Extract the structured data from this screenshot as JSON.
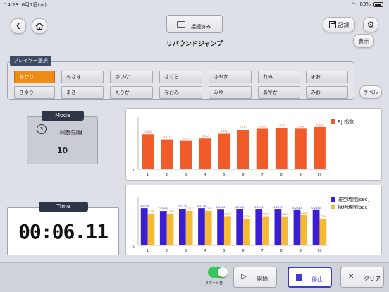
{
  "status_bar": {
    "time": "14:23",
    "date": "6月7日(水)",
    "battery": "83%"
  },
  "header": {
    "connection_label": "接続済み",
    "title": "リバウンドジャンプ",
    "record_label": "記録",
    "display_label": "表示"
  },
  "players": {
    "legend": "プレイヤー選択",
    "row1": [
      "あかり",
      "みさき",
      "ゆいな",
      "さくら",
      "さやか",
      "れみ",
      "まお"
    ],
    "row2": [
      "さゆり",
      "まき",
      "えりか",
      "なおみ",
      "みゆ",
      "あやか",
      "みお"
    ],
    "selected": "あかり",
    "label_button": "ラベル"
  },
  "mode": {
    "title": "Mode",
    "label": "回数制限",
    "value": "10",
    "icon_text": "3"
  },
  "timer": {
    "title": "Time",
    "value": "00:06.11"
  },
  "controls": {
    "start_sound_label": "スタート音",
    "start_label": "開始",
    "stop_label": "停止",
    "clear_label": "クリア"
  },
  "colors": {
    "rj": "#f15a29",
    "flight": "#3a1ed6",
    "contact": "#f5b935",
    "selected_player": "#ee8c16"
  },
  "chart_data": [
    {
      "type": "bar",
      "categories": [
        "1",
        "2",
        "3",
        "4",
        "5",
        "6",
        "7",
        "8",
        "9",
        "10"
      ],
      "series": [
        {
          "name": "RJ 指数",
          "values": [
            0.366,
            0.312,
            0.297,
            0.322,
            0.371,
            0.411,
            0.423,
            0.433,
            0.424,
            0.442
          ]
        }
      ],
      "ylim": [
        0,
        0.5
      ],
      "y_tick_labels": [
        "0"
      ],
      "legend": "top-right"
    },
    {
      "type": "bar",
      "categories": [
        "1",
        "2",
        "3",
        "4",
        "5",
        "6",
        "7",
        "8",
        "9",
        "10"
      ],
      "series": [
        {
          "name": "滞空時間[sec]",
          "values": [
            0.277,
            0.256,
            0.272,
            0.277,
            0.266,
            0.267,
            0.267,
            0.267,
            0.263,
            0.263
          ]
        },
        {
          "name": "接地時間[sec]",
          "values": [
            0.236,
            0.236,
            0.257,
            0.257,
            0.218,
            0.2,
            0.217,
            0.216,
            0.226,
            0.2
          ]
        }
      ],
      "ylim": [
        0,
        0.33
      ],
      "y_tick_labels": [
        "0"
      ],
      "legend": "top-right"
    }
  ]
}
